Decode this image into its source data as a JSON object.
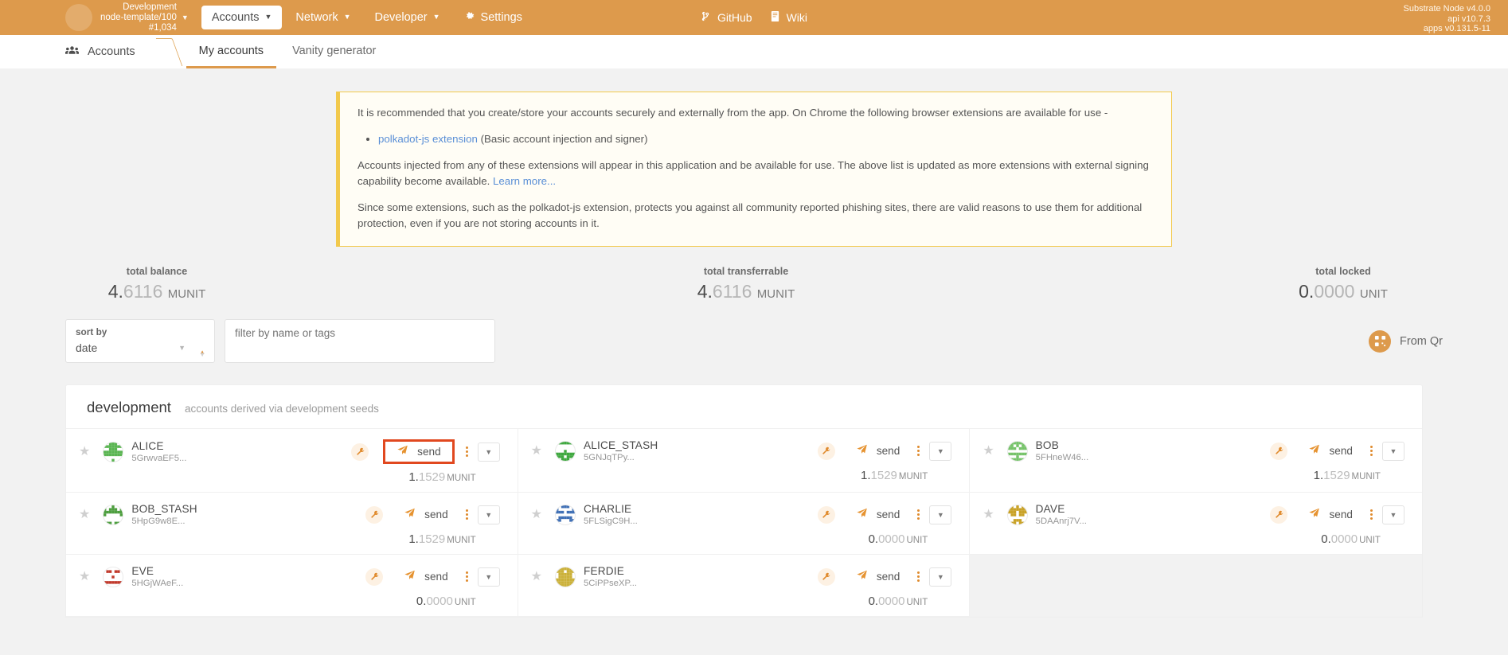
{
  "topbar": {
    "chain_name": "Development",
    "chain_spec": "node-template/100",
    "block": "#1,034",
    "caret": "▼",
    "nav": [
      {
        "label": "Accounts",
        "caret": "▼",
        "active": true
      },
      {
        "label": "Network",
        "caret": "▼",
        "active": false
      },
      {
        "label": "Developer",
        "caret": "▼",
        "active": false
      },
      {
        "label": "Settings",
        "caret": "",
        "active": false
      }
    ],
    "links": [
      {
        "label": "GitHub",
        "icon": "git-branch-icon"
      },
      {
        "label": "Wiki",
        "icon": "book-icon"
      }
    ],
    "versions": [
      "Substrate Node v4.0.0",
      "api v10.7.3",
      "apps v0.131.5-11"
    ],
    "accent": "#dd9a4c"
  },
  "tabs": {
    "breadcrumb": "Accounts",
    "breadcrumb_icon": "people-icon",
    "items": [
      {
        "label": "My accounts",
        "active": true
      },
      {
        "label": "Vanity generator",
        "active": false
      }
    ]
  },
  "banner": {
    "paragraph1": "It is recommended that you create/store your accounts securely and externally from the app. On Chrome the following browser extensions are available for use -",
    "bullets": [
      {
        "link": "polkadot-js extension",
        "rest": " (Basic account injection and signer)"
      }
    ],
    "paragraph2_a": "Accounts injected from any of these extensions will appear in this application and be available for use. The above list is updated as more extensions with external signing capability become available. ",
    "paragraph2_link": "Learn more...",
    "paragraph3": "Since some extensions, such as the polkadot-js extension, protects you against all community reported phishing sites, there are valid reasons to use them for additional protection, even if you are not storing accounts in it.",
    "border_color": "#f2c94c"
  },
  "summary": [
    {
      "label": "total balance",
      "whole": "4.",
      "frac": "6116",
      "unit": "MUNIT"
    },
    {
      "label": "total transferrable",
      "whole": "4.",
      "frac": "6116",
      "unit": "MUNIT"
    },
    {
      "label": "total locked",
      "whole": "0.",
      "frac": "0000",
      "unit": "UNIT"
    }
  ],
  "controls": {
    "sort_label": "sort by",
    "sort_value": "date",
    "sort_caret": "▼",
    "spinner_up": "▲",
    "spinner_down": "▼",
    "filter_placeholder": "filter by name or tags",
    "filter_value": "",
    "from_qr_label": "From Qr",
    "from_qr_icon": "qr-code-icon"
  },
  "group": {
    "name": "development",
    "description": "accounts derived via development seeds"
  },
  "accounts": [
    {
      "name": "ALICE",
      "address": "5GrwvaEF5...",
      "send_label": "send",
      "balance_whole": "1.",
      "balance_frac": "1529",
      "balance_unit": "MUNIT",
      "focused": true,
      "identicon_color": "#5ab552"
    },
    {
      "name": "ALICE_STASH",
      "address": "5GNJqTPy...",
      "send_label": "send",
      "balance_whole": "1.",
      "balance_frac": "1529",
      "balance_unit": "MUNIT",
      "focused": false,
      "identicon_color": "#3fa83f"
    },
    {
      "name": "BOB",
      "address": "5FHneW46...",
      "send_label": "send",
      "balance_whole": "1.",
      "balance_frac": "1529",
      "balance_unit": "MUNIT",
      "focused": false,
      "identicon_color": "#76c36a"
    },
    {
      "name": "BOB_STASH",
      "address": "5HpG9w8E...",
      "send_label": "send",
      "balance_whole": "1.",
      "balance_frac": "1529",
      "balance_unit": "MUNIT",
      "focused": false,
      "identicon_color": "#4d9e3f"
    },
    {
      "name": "CHARLIE",
      "address": "5FLSigC9H...",
      "send_label": "send",
      "balance_whole": "0.",
      "balance_frac": "0000",
      "balance_unit": "UNIT",
      "focused": false,
      "identicon_color": "#3f6fb5"
    },
    {
      "name": "DAVE",
      "address": "5DAAnrj7V...",
      "send_label": "send",
      "balance_whole": "0.",
      "balance_frac": "0000",
      "balance_unit": "UNIT",
      "focused": false,
      "identicon_color": "#c9a227"
    },
    {
      "name": "EVE",
      "address": "5HGjWAeF...",
      "send_label": "send",
      "balance_whole": "0.",
      "balance_frac": "0000",
      "balance_unit": "UNIT",
      "focused": false,
      "identicon_color": "#c0392b"
    },
    {
      "name": "FERDIE",
      "address": "5CiPPseXP...",
      "send_label": "send",
      "balance_whole": "0.",
      "balance_frac": "0000",
      "balance_unit": "UNIT",
      "focused": false,
      "identicon_color": "#cbb13a"
    }
  ],
  "icons": {
    "star": "★",
    "wrench": "🔧",
    "paper_plane": "➤",
    "caret_down": "▼"
  }
}
